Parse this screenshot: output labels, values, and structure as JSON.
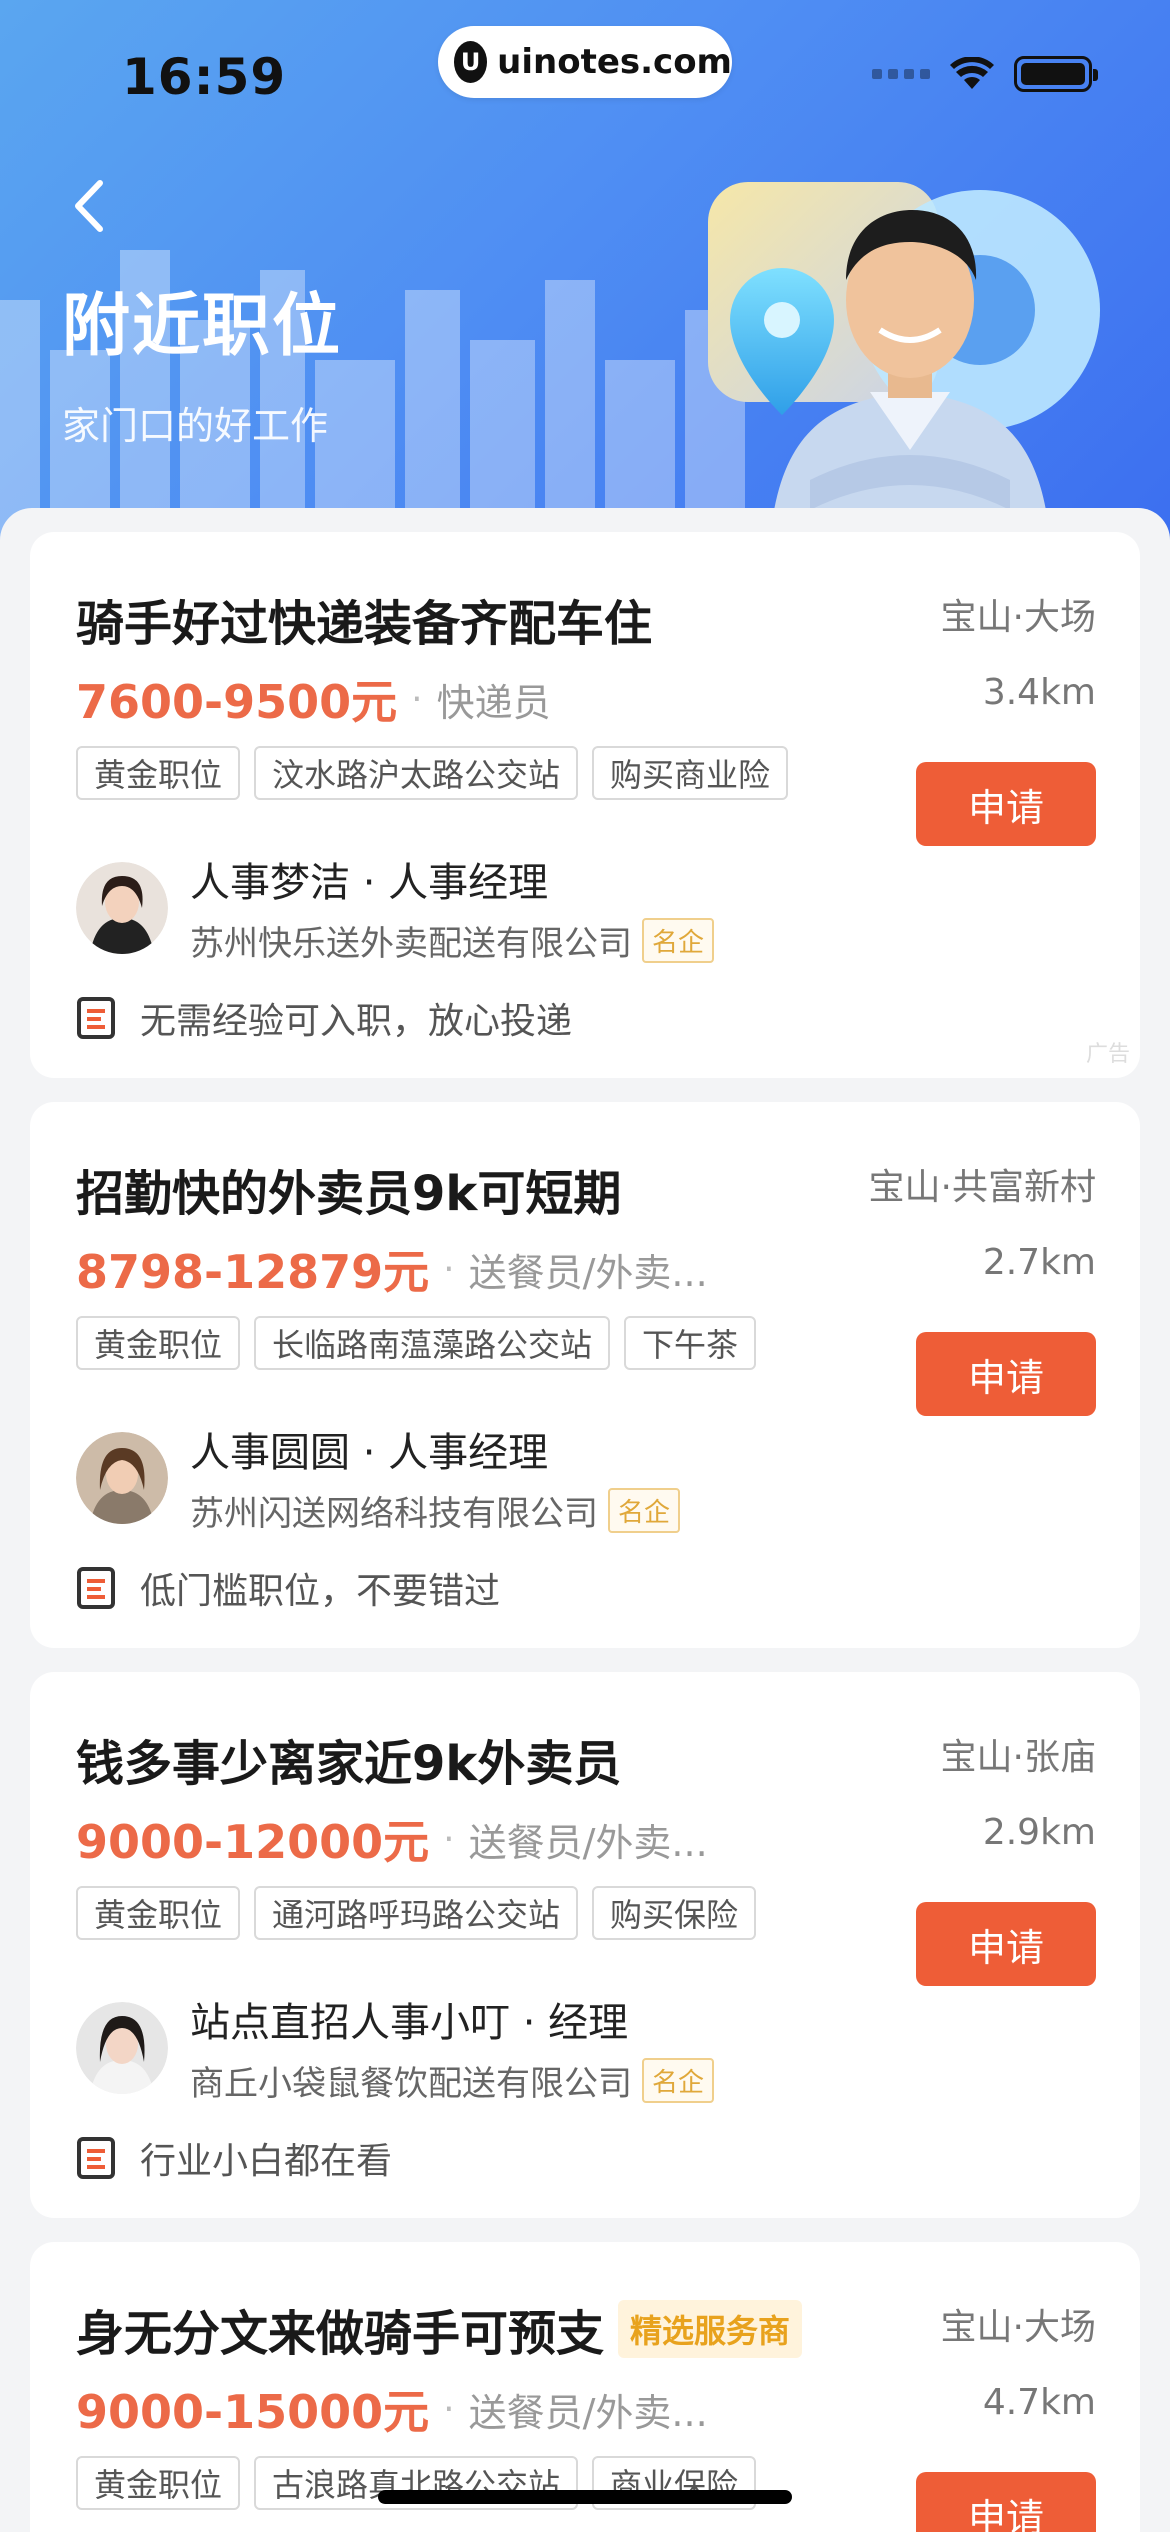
{
  "status_bar": {
    "time": "16:59",
    "domain": "uinotes.com"
  },
  "header": {
    "title": "附近职位",
    "subtitle": "家门口的好工作"
  },
  "jobs": [
    {
      "title": "骑手好过快递装备齐配车住",
      "promo": "",
      "location": "宝山·大场",
      "salary": "7600-9500元",
      "category": "快递员",
      "distance": "3.4km",
      "tags": [
        "黄金职位",
        "汶水路沪太路公交站",
        "购买商业险"
      ],
      "apply_label": "申请",
      "recruiter": "人事梦洁 · 人事经理",
      "company": "苏州快乐送外卖配送有限公司",
      "company_badge": "名企",
      "highlight": "无需经验可入职，放心投递",
      "ad_label": "广告"
    },
    {
      "title": "招勤快的外卖员9k可短期",
      "promo": "",
      "location": "宝山·共富新村",
      "salary": "8798-12879元",
      "category": "送餐员/外卖...",
      "distance": "2.7km",
      "tags": [
        "黄金职位",
        "长临路南蕰藻路公交站",
        "下午茶"
      ],
      "apply_label": "申请",
      "recruiter": "人事圆圆 · 人事经理",
      "company": "苏州闪送网络科技有限公司",
      "company_badge": "名企",
      "highlight": "低门槛职位，不要错过"
    },
    {
      "title": "钱多事少离家近9k外卖员",
      "promo": "",
      "location": "宝山·张庙",
      "salary": "9000-12000元",
      "category": "送餐员/外卖...",
      "distance": "2.9km",
      "tags": [
        "黄金职位",
        "通河路呼玛路公交站",
        "购买保险"
      ],
      "apply_label": "申请",
      "recruiter": "站点直招人事小叮 · 经理",
      "company": "商丘小袋鼠餐饮配送有限公司",
      "company_badge": "名企",
      "highlight": "行业小白都在看"
    },
    {
      "title": "身无分文来做骑手可预支",
      "promo": "精选服务商",
      "location": "宝山·大场",
      "salary": "9000-15000元",
      "category": "送餐员/外卖...",
      "distance": "4.7km",
      "tags": [
        "黄金职位",
        "古浪路真北路公交站",
        "商业保险"
      ],
      "apply_label": "申请"
    }
  ],
  "colors": {
    "accent": "#ee5d37",
    "salary": "#ec6a48",
    "header_blue": "#4f8ef3"
  }
}
